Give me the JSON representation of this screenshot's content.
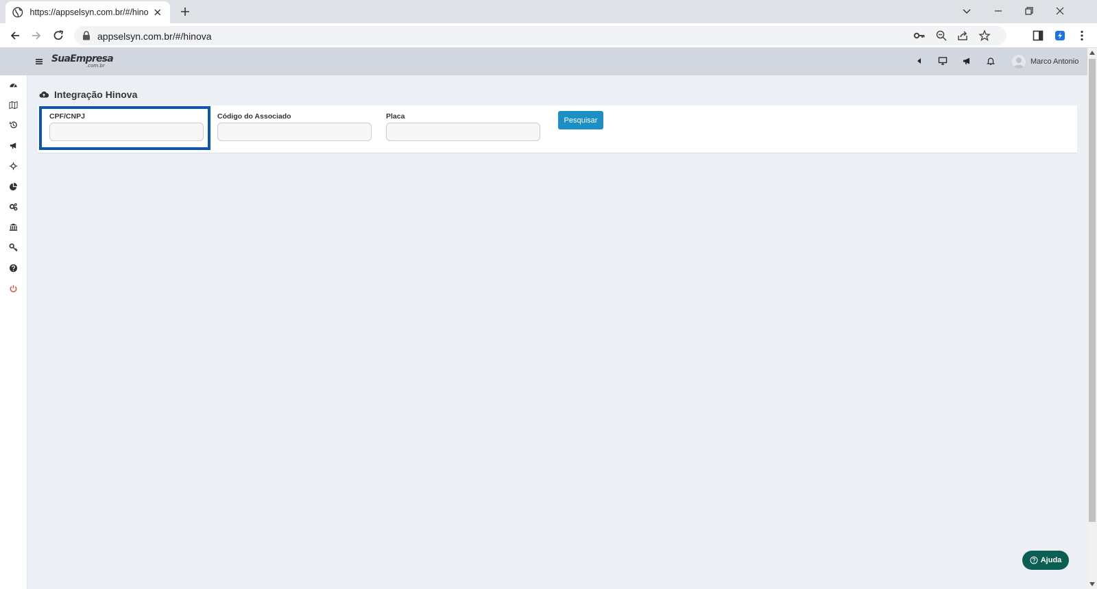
{
  "browser": {
    "tab_title": "https://appselsyn.com.br/#/hinova",
    "url": "appselsyn.com.br/#/hinova"
  },
  "header": {
    "logo_main": "SuaEmpresa",
    "logo_sub": ".com.br",
    "user_name": "Marco Antonio"
  },
  "sidebar": {
    "items": [
      {
        "icon": "dashboard-icon"
      },
      {
        "icon": "map-icon"
      },
      {
        "icon": "history-icon"
      },
      {
        "icon": "megaphone-icon"
      },
      {
        "icon": "crosshair-icon"
      },
      {
        "icon": "pie-chart-icon"
      },
      {
        "icon": "cogs-icon"
      },
      {
        "icon": "bank-icon"
      },
      {
        "icon": "key-icon"
      },
      {
        "icon": "help-circle-icon"
      },
      {
        "icon": "power-icon",
        "color": "#dd4b39"
      }
    ]
  },
  "page": {
    "title": "Integração Hinova",
    "form": {
      "cpf_label": "CPF/CNPJ",
      "cpf_value": "",
      "codigo_label": "Código do Associado",
      "codigo_value": "",
      "placa_label": "Placa",
      "placa_value": "",
      "search_label": "Pesquisar"
    },
    "help_label": "Ajuda"
  },
  "colors": {
    "header_bg": "#d2d6de",
    "content_bg": "#ecf0f5",
    "primary_button": "#1c8fc4",
    "help_button": "#0b5e52",
    "focus_highlight": "#0b55b5"
  }
}
